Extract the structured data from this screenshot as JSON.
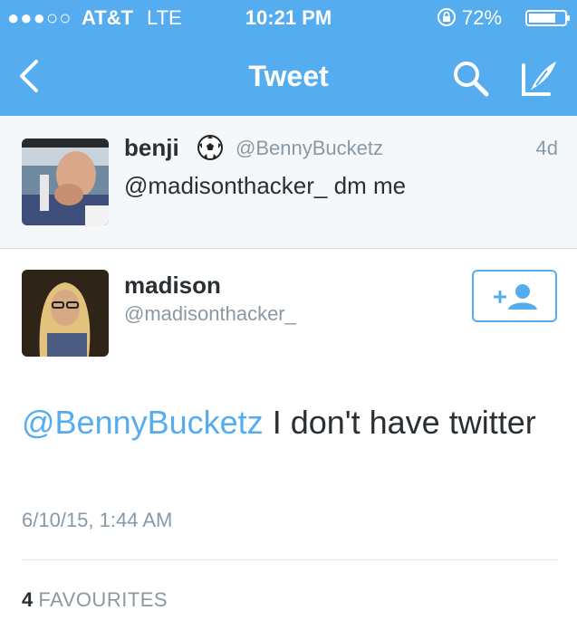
{
  "status_bar": {
    "signal": "●●●○○",
    "carrier": "AT&T",
    "network": "LTE",
    "time": "10:21 PM",
    "battery": "72%"
  },
  "nav": {
    "title": "Tweet"
  },
  "parent_tweet": {
    "name": "benji",
    "handle": "@BennyBucketz",
    "time": "4d",
    "text": "@madisonthacker_ dm me"
  },
  "tweet": {
    "name": "madison",
    "handle": "@madisonthacker_",
    "mention": "@BennyBucketz",
    "text_rest": " I don't have twitter",
    "timestamp": "6/10/15, 1:44 AM",
    "favourites_count": "4",
    "favourites_label": "FAVOURITES"
  },
  "colors": {
    "accent": "#55acee",
    "secondary_text": "#8899a6",
    "primary_text": "#292f33"
  }
}
